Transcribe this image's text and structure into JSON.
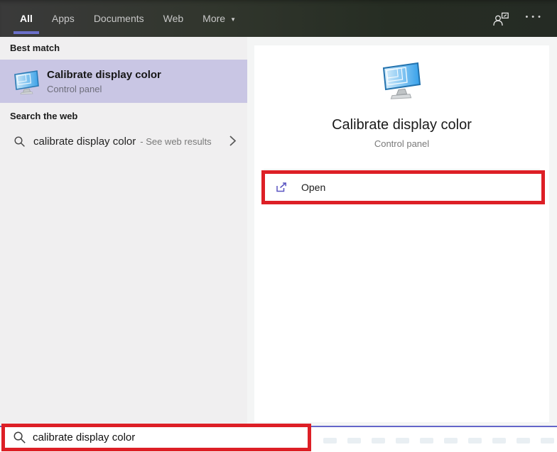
{
  "topbar": {
    "tabs": [
      {
        "label": "All",
        "selected": true
      },
      {
        "label": "Apps",
        "selected": false
      },
      {
        "label": "Documents",
        "selected": false
      },
      {
        "label": "Web",
        "selected": false
      },
      {
        "label": "More",
        "selected": false,
        "has_dropdown": true
      }
    ],
    "right_icons": [
      {
        "name": "sign-in-options-icon"
      },
      {
        "name": "ellipsis-icon",
        "glyph": "•••"
      }
    ]
  },
  "left_panel": {
    "best_match_header": "Best match",
    "best_match": {
      "title": "Calibrate display color",
      "subtitle": "Control panel",
      "icon": "display-calibration-icon"
    },
    "search_web_header": "Search the web",
    "web_suggestion": {
      "query": "calibrate display color",
      "suffix": "- See web results",
      "icon": "search-icon",
      "chevron": "chevron-right-icon"
    }
  },
  "preview_panel": {
    "icon": "display-calibration-icon",
    "title": "Calibrate display color",
    "subtitle": "Control panel",
    "actions": [
      {
        "label": "Open",
        "icon": "open-external-icon"
      }
    ]
  },
  "search_bar": {
    "icon": "search-icon",
    "value": "calibrate display color"
  },
  "annotations": {
    "color": "#dd1f26",
    "targets": [
      "open-action",
      "search-bar"
    ]
  },
  "colors": {
    "accent_purple": "#6a6fc9",
    "search_border_purple": "#6466c9",
    "best_match_highlight": "#c9c6e4",
    "topbar_bg": "#2c312a",
    "left_panel_bg": "#f0eff0",
    "preview_panel_bg": "#f4f5f5",
    "card_bg": "#ffffff",
    "annotation_red": "#dd1f26"
  }
}
